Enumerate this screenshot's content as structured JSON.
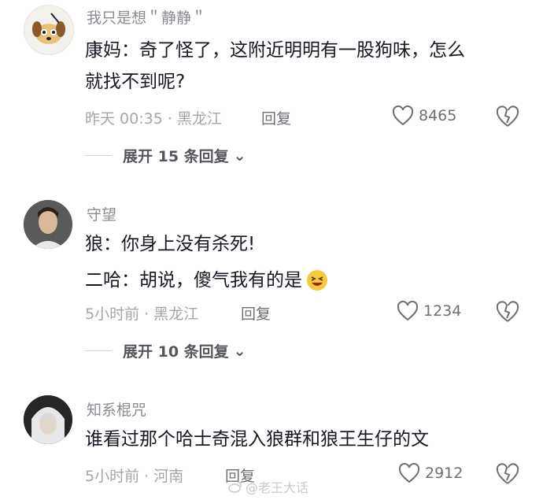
{
  "comments": [
    {
      "username": "我只是想＂静静＂",
      "lines": [
        "康妈：奇了怪了，这附近明明有一股狗味，怎么",
        "就找不到呢?"
      ],
      "time_location": "昨天 00:35 · 黑龙江",
      "reply_label": "回复",
      "likes": "8465",
      "expand_label": "展开 15 条回复"
    },
    {
      "username": "守望",
      "lines": [
        "狼：你身上没有杀死!",
        "二哈：胡说，傻气我有的是"
      ],
      "time_location": "5小时前 · 黑龙江",
      "reply_label": "回复",
      "likes": "1234",
      "expand_label": "展开 10 条回复"
    },
    {
      "username": "知系棍咒",
      "lines": [
        "谁看过那个哈士奇混入狼群和狼王生仔的文"
      ],
      "time_location": "5小时前 · 河南",
      "reply_label": "回复",
      "likes": "2912"
    }
  ],
  "watermark": "@老王大话",
  "colors": {
    "text": "#161823",
    "meta": "#a5a6ab",
    "username": "#8a8b91"
  }
}
